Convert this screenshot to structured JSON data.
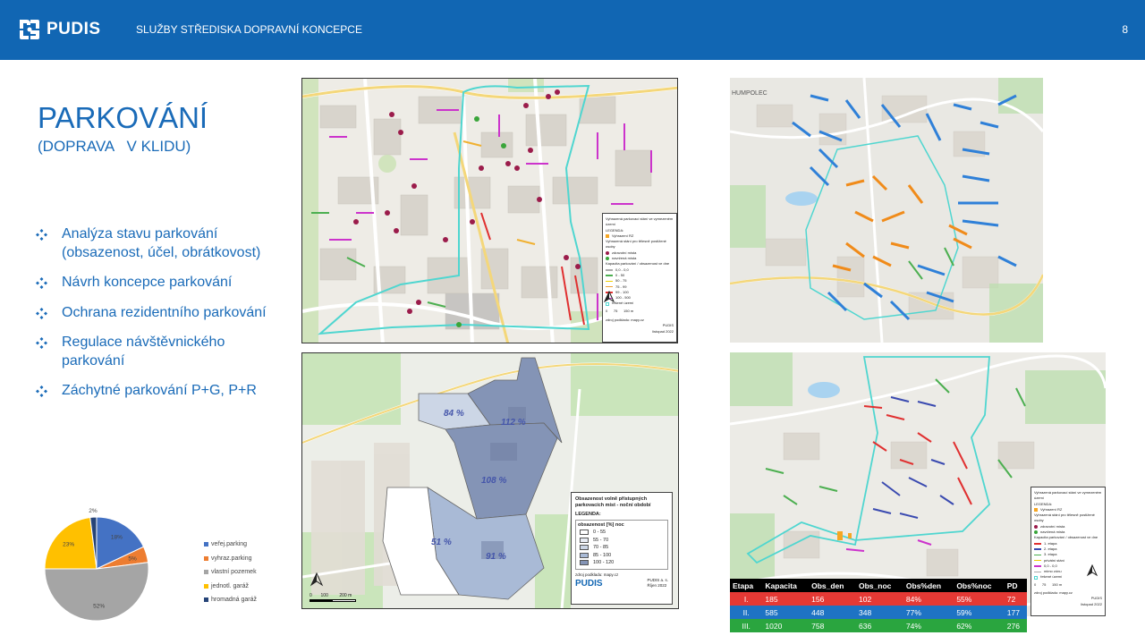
{
  "header": {
    "brand": "PUDIS",
    "title": "SLUŽBY STŘEDISKA DOPRAVNÍ KONCEPCE",
    "page_number": "8",
    "bg_color": "#1166b3"
  },
  "slide": {
    "title": "PARKOVÁNÍ",
    "subtitle": "(DOPRAVA   V KLIDU)",
    "accent": "#1a6bb8",
    "bullets": [
      {
        "icon": "diamond-bullet-icon",
        "text": "Analýza stavu parkování (obsazenost, účel, obrátkovost)"
      },
      {
        "icon": "diamond-bullet-icon",
        "text": "Návrh koncepce parkování"
      },
      {
        "icon": "diamond-bullet-icon",
        "text": "Ochrana rezidentního parkování"
      },
      {
        "icon": "diamond-bullet-icon",
        "text": "Regulace návštěvnického parkování"
      },
      {
        "icon": "diamond-bullet-icon",
        "text": "Záchytné parkování P+G, P+R"
      }
    ]
  },
  "chart_data": {
    "type": "pie",
    "title": "",
    "slices": [
      {
        "label": "veřej.parking",
        "value": 18,
        "display": "18%",
        "color": "#4472c4"
      },
      {
        "label": "vyhraz.parking",
        "value": 5,
        "display": "5%",
        "color": "#ed7d31"
      },
      {
        "label": "vlastní pozemek",
        "value": 52,
        "display": "52%",
        "color": "#a5a5a5"
      },
      {
        "label": "jednotl. garáž",
        "value": 23,
        "display": "23%",
        "color": "#ffc000"
      },
      {
        "label": "hromadná garáž",
        "value": 2,
        "display": "2%",
        "color": "#264478"
      }
    ],
    "legend_position": "right"
  },
  "maps": {
    "map1": {
      "legend_lines": [
        "Vyhrazená parkovací stání ve vymezeném území",
        "LEGENDA:",
        "Vyhrazení RZ",
        "Vyhrazená stání pro tělesně postižené osoby",
        "zdravotní místa",
        "navržená místa",
        "Kapacita parkování / obsazenost ve dne",
        "0,0 - 0,0",
        "0 - 50",
        "50 - 75",
        "75 - 99",
        "99 - 100",
        "100 - 500",
        "řešené území",
        "zdroj podkladu: mapy.cz",
        "PUDIS",
        "listopad 2022"
      ],
      "scale": [
        "0",
        "75",
        "150 m"
      ]
    },
    "map2": {
      "town": "HUMPOLEC"
    },
    "map3": {
      "labels": [
        "84 %",
        "112 %",
        "108 %",
        "51 %",
        "91 %"
      ],
      "legend_title": "Obsazenost volně přístupných parkovacích míst - noční období",
      "legend_sub": "LEGENDA:",
      "legend_head": "obsazenost [%] noc",
      "classes": [
        {
          "label": "0 - 55",
          "color": "#ffffff"
        },
        {
          "label": "55 - 70",
          "color": "#e8ecf4"
        },
        {
          "label": "70 - 85",
          "color": "#ccd6e6"
        },
        {
          "label": "85 - 100",
          "color": "#a9bad6"
        },
        {
          "label": "100 - 120",
          "color": "#8494b6"
        }
      ],
      "source": "zdroj podkladu: mapy.cz",
      "brand": "PUDIS",
      "company": "PUDIS a. s.",
      "date": "Říjen 2022",
      "scale": [
        "0",
        "100",
        "200 m"
      ]
    },
    "map4": {
      "legend_lines": [
        "Vyhrazená parkovací stání ve vymezeném území",
        "LEGENDA:",
        "Vyhrazení RZ",
        "Vyhrazená stání pro tělesně postižené osoby",
        "zdravotní místa",
        "navržená místa",
        "Kapacita parkování / obsazenost ve dne",
        "1. etapa",
        "2. etapa",
        "3. etapa",
        "privátní stání",
        "0,0 - 0,0",
        "mimo zónu",
        "řešené území",
        "zdroj podkladu: mapy.cz",
        "PUDIS",
        "listopad 2022"
      ],
      "scale": [
        "0",
        "75",
        "150 m"
      ]
    }
  },
  "table": {
    "headers": [
      "Etapa",
      "Kapacita",
      "Obs_den",
      "Obs_noc",
      "Obs%den",
      "Obs%noc",
      "PD"
    ],
    "rows": [
      [
        "I.",
        "185",
        "156",
        "102",
        "84%",
        "55%",
        "72"
      ],
      [
        "II.",
        "585",
        "448",
        "348",
        "77%",
        "59%",
        "177"
      ],
      [
        "III.",
        "1020",
        "758",
        "636",
        "74%",
        "62%",
        "276"
      ]
    ]
  }
}
